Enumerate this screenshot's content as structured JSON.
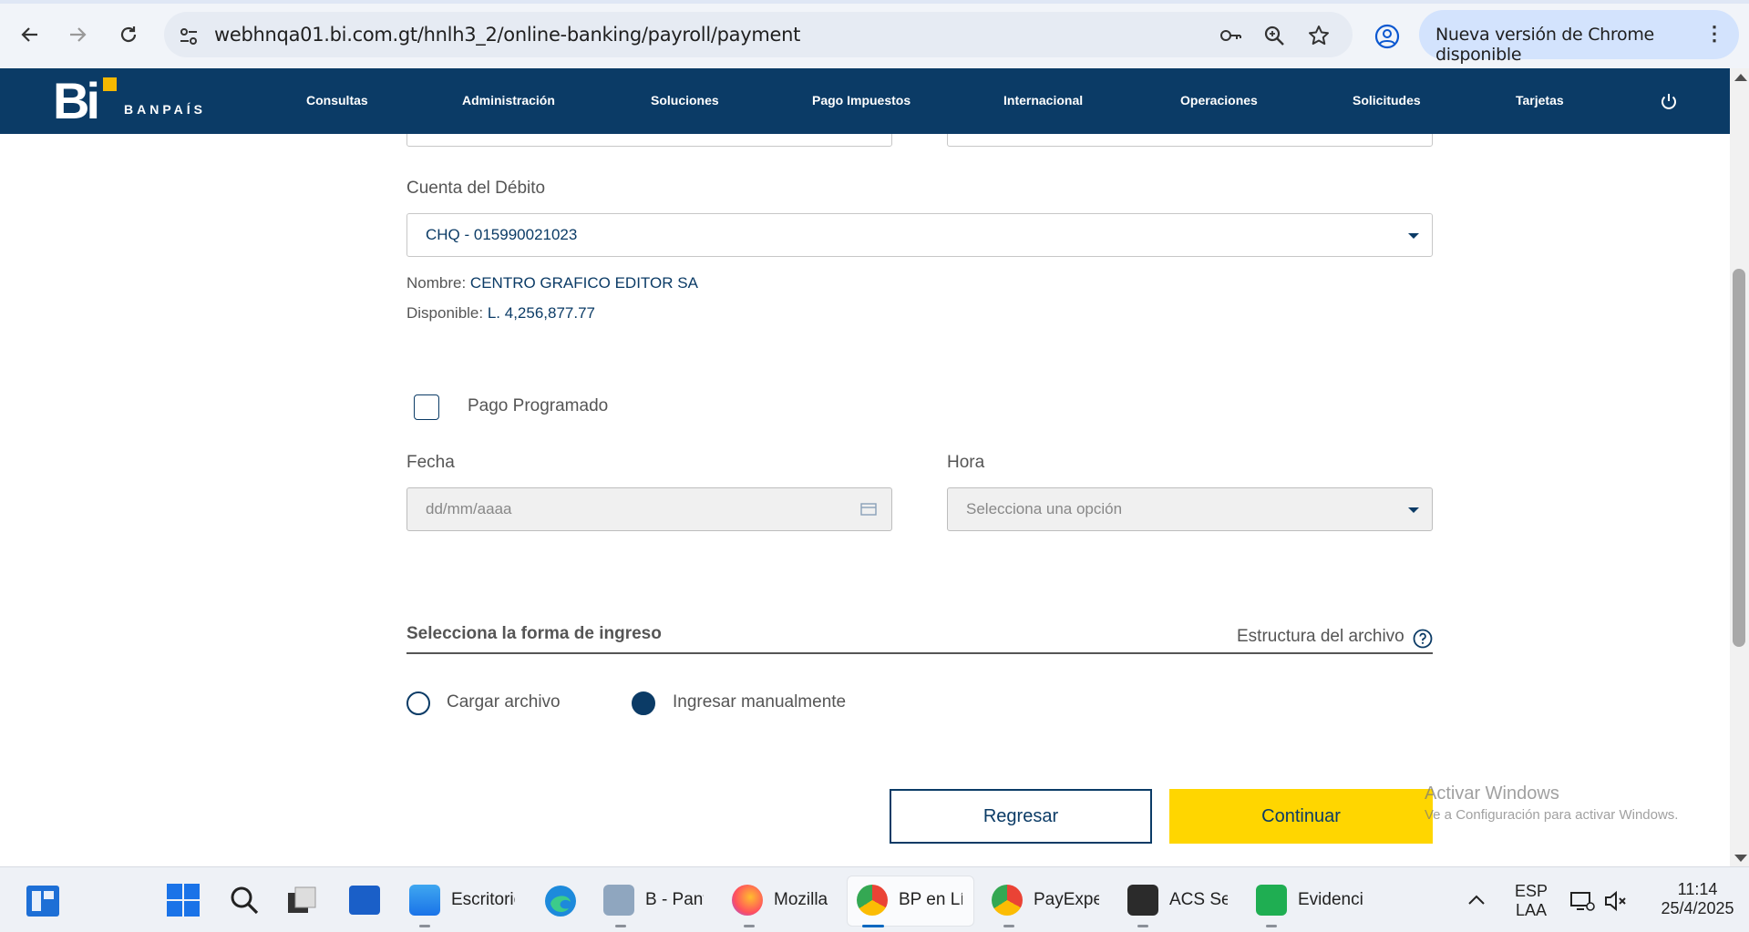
{
  "browser": {
    "url": "webhnqa01.bi.com.gt/hnlh3_2/online-banking/payroll/payment",
    "update_label": "Nueva versión de Chrome disponible",
    "menu_glyph": "⋮"
  },
  "header": {
    "logo_text": "Bi",
    "brand_name": "BANPAÍS",
    "menu": [
      "Consultas",
      "Administración",
      "Soluciones",
      "Pago Impuestos",
      "Internacional",
      "Operaciones",
      "Solicitudes",
      "Tarjetas"
    ]
  },
  "form": {
    "debit_account_label": "Cuenta del Débito",
    "debit_account_value": "CHQ - 015990021023",
    "name_label": "Nombre:",
    "name_value": "CENTRO GRAFICO EDITOR SA",
    "available_label": "Disponible:",
    "available_value": "L. 4,256,877.77",
    "scheduled_label": "Pago Programado",
    "scheduled_checked": false,
    "date_label": "Fecha",
    "date_placeholder": "dd/mm/aaaa",
    "time_label": "Hora",
    "time_placeholder": "Selecciona una opción",
    "entry_section_title": "Selecciona la forma de ingreso",
    "file_structure_link": "Estructura del archivo",
    "option_upload": "Cargar archivo",
    "option_manual": "Ingresar manualmente",
    "selected_option": "Ingresar manualmente",
    "back_button": "Regresar",
    "continue_button": "Continuar"
  },
  "watermark": {
    "line1": "Activar Windows",
    "line2": "Ve a Configuración para activar Windows."
  },
  "taskbar": {
    "items": [
      {
        "label": "Escritorio"
      },
      {
        "label": "B - Pant"
      },
      {
        "label": "Mozilla"
      },
      {
        "label": "BP en Lír"
      },
      {
        "label": "PayExpec"
      },
      {
        "label": "ACS Ses"
      },
      {
        "label": "Evidencia"
      }
    ],
    "lang_top": "ESP",
    "lang_bottom": "LAA",
    "time": "11:14",
    "date": "25/4/2025"
  },
  "colors": {
    "brand_navy": "#0b3b66",
    "brand_yellow": "#ffd600",
    "logo_accent": "#f5b800"
  }
}
